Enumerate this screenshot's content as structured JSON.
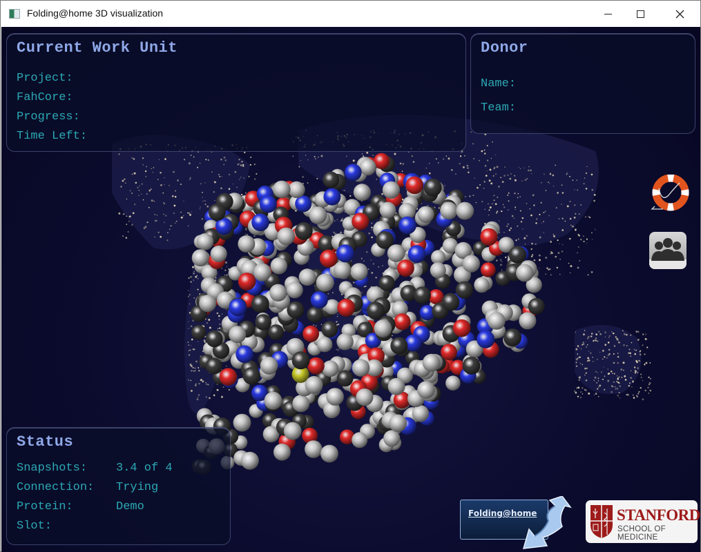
{
  "window": {
    "title": "Folding@home 3D visualization",
    "controls": {
      "minimize": "minimize",
      "maximize": "maximize",
      "close": "close"
    }
  },
  "work_unit": {
    "heading": "Current Work Unit",
    "fields": [
      {
        "label": "Project:",
        "value": ""
      },
      {
        "label": "FahCore:",
        "value": ""
      },
      {
        "label": "Progress:",
        "value": ""
      },
      {
        "label": "Time Left:",
        "value": ""
      }
    ]
  },
  "donor": {
    "heading": "Donor",
    "fields": [
      {
        "label": "Name:",
        "value": ""
      },
      {
        "label": "Team:",
        "value": ""
      }
    ]
  },
  "status": {
    "heading": "Status",
    "fields": [
      {
        "label": "Snapshots:",
        "value": "3.4 of 4"
      },
      {
        "label": "Connection:",
        "value": "Trying"
      },
      {
        "label": "Protein:",
        "value": "Demo"
      },
      {
        "label": "Slot:",
        "value": ""
      }
    ]
  },
  "side_buttons": {
    "help": "help-lifering-icon",
    "groups": "groups-icon"
  },
  "logos": {
    "fah": "Folding@home",
    "stanford_name": "STANFORD",
    "stanford_sub": "SCHOOL OF MEDICINE"
  },
  "molecule": {
    "protein": "Demo",
    "atom_colors": {
      "carbon_light": "#c8c8c8",
      "carbon_dark": "#3e3e3e",
      "oxygen": "#e02a2a",
      "nitrogen": "#2a3ae0",
      "sulfur": "#c8c82a"
    }
  },
  "colors": {
    "heading": "#8fa8e8",
    "label": "#2ba8b4",
    "ocean": "#0b0b2e",
    "city_lights": "#f0e6c0"
  }
}
